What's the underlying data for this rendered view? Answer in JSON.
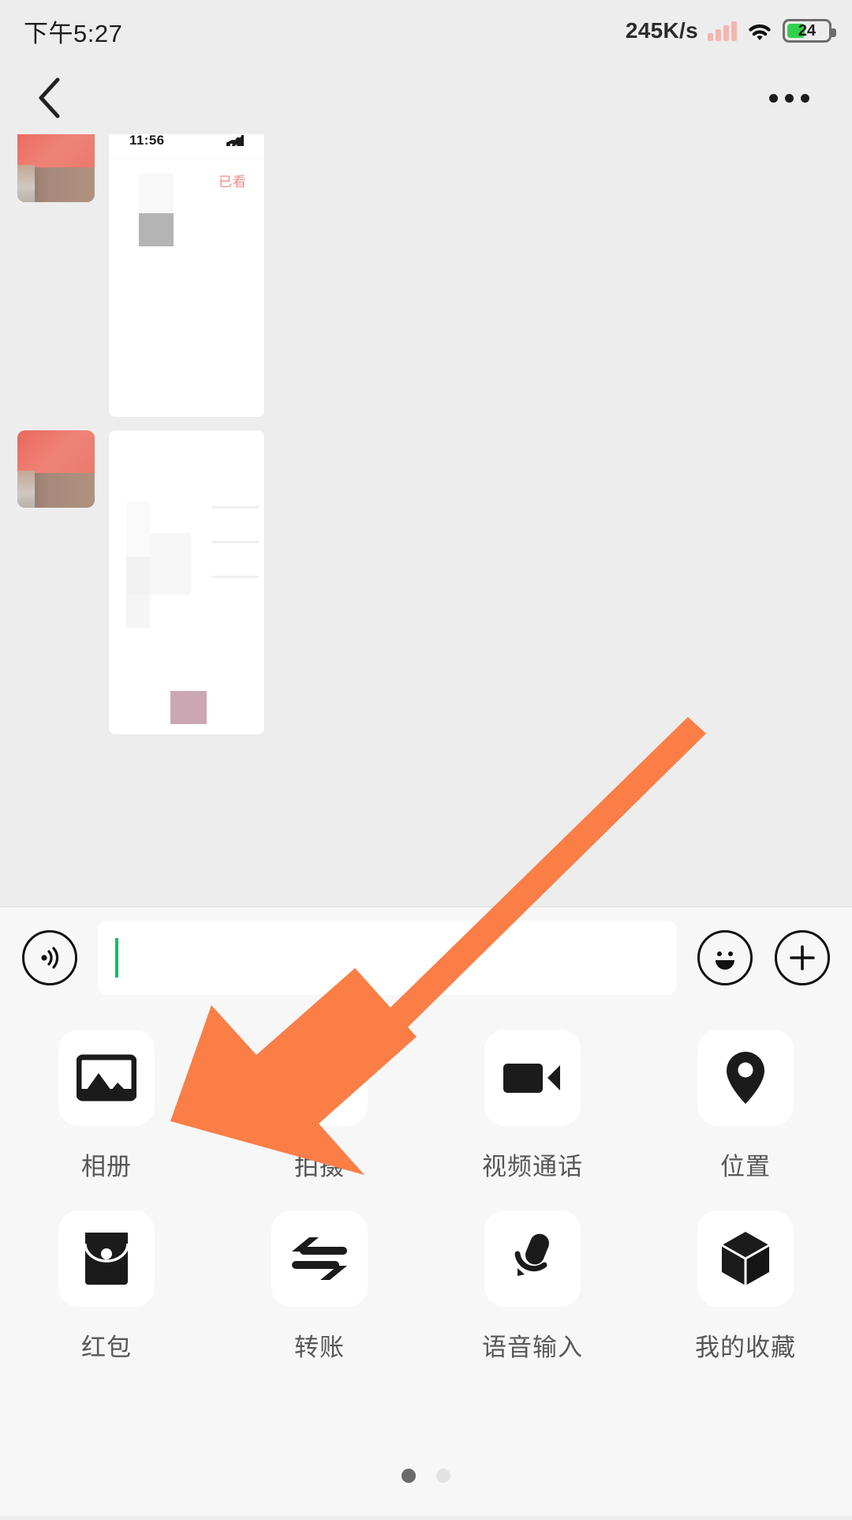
{
  "status_bar": {
    "time": "下午5:27",
    "network_speed": "245K/s",
    "battery_percent": "24",
    "signal_icon": "signal-bars-icon",
    "wifi_icon": "wifi-icon",
    "battery_icon": "battery-icon"
  },
  "nav_bar": {
    "back_icon": "back-chevron-icon",
    "more_icon": "more-options-icon",
    "title": ""
  },
  "chat": {
    "messages": [
      {
        "sender": "contact",
        "type": "image-screenshot",
        "inner_time": "11:56",
        "inner_red_text": "已看"
      },
      {
        "sender": "contact",
        "type": "image-screenshot",
        "inner_time": "",
        "inner_red_text": ""
      }
    ]
  },
  "input_bar": {
    "voice_icon": "voice-input-icon",
    "emoji_icon": "emoji-icon",
    "plus_icon": "plus-icon",
    "text_value": "",
    "placeholder": ""
  },
  "panel": {
    "items": [
      {
        "label": "相册",
        "icon": "photo-album-icon"
      },
      {
        "label": "拍摄",
        "icon": "camera-icon"
      },
      {
        "label": "视频通话",
        "icon": "video-call-icon"
      },
      {
        "label": "位置",
        "icon": "location-pin-icon"
      },
      {
        "label": "红包",
        "icon": "red-packet-icon"
      },
      {
        "label": "转账",
        "icon": "transfer-icon"
      },
      {
        "label": "语音输入",
        "icon": "microphone-icon"
      },
      {
        "label": "我的收藏",
        "icon": "favorites-cube-icon"
      }
    ],
    "page_dots": {
      "count": 2,
      "active_index": 0
    }
  },
  "annotation": {
    "arrow_color": "#fa7e46",
    "points_to": "相册"
  },
  "colors": {
    "chat_background": "#ededed",
    "panel_background": "#f7f7f7",
    "bubble_background": "#ffffff",
    "caret_green": "#07c160",
    "battery_green": "#32d04d",
    "label_gray": "#575757"
  }
}
